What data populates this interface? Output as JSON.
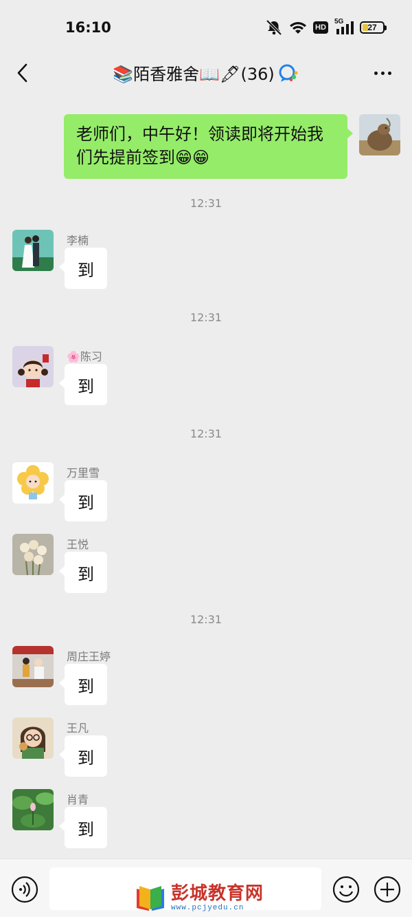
{
  "status_bar": {
    "time": "16:10",
    "network": "5G",
    "hd_label": "HD",
    "battery_level": "27",
    "battery_fraction": 0.27,
    "icons": [
      "mute-icon",
      "wifi-icon",
      "hd-icon",
      "signal-5g-icon",
      "battery-icon"
    ]
  },
  "header": {
    "title": "📚陌香雅舍📖🖋(36)",
    "back_icon": "back-chevron-icon",
    "more_icon": "more-dots-icon"
  },
  "messages": {
    "self": {
      "text": "老师们，中午好！领读即将开始我们先提前签到😁😁",
      "avatar": "capybara-photo"
    },
    "timestamps": [
      "12:31",
      "12:31",
      "12:31",
      "12:31"
    ],
    "group1": [
      {
        "sender": "李楠",
        "text": "到",
        "avatar": "couple-photo"
      }
    ],
    "group2": [
      {
        "sender": "🌸陈习",
        "text": "到",
        "avatar": "cartoon-girl"
      }
    ],
    "group3": [
      {
        "sender": "万里雪",
        "text": "到",
        "avatar": "flower-girl"
      },
      {
        "sender": "王悦",
        "text": "到",
        "avatar": "tulip-photo"
      }
    ],
    "group4": [
      {
        "sender": "周庄王婷",
        "text": "到",
        "avatar": "kids-photo"
      },
      {
        "sender": "王凡",
        "text": "到",
        "avatar": "cartoon-woman"
      },
      {
        "sender": "肖青",
        "text": "到",
        "avatar": "lotus-photo"
      }
    ]
  },
  "input_bar": {
    "icons": [
      "voice-icon",
      "emoji-icon",
      "plus-icon"
    ],
    "placeholder": ""
  },
  "watermark": {
    "title": "彭城教育网",
    "url": "www.pcjyedu.cn"
  },
  "colors": {
    "background": "#ededed",
    "self_bubble": "#95ec69",
    "other_bubble": "#ffffff",
    "timestamp": "#8a8a8a",
    "watermark_red": "#c8332b",
    "watermark_blue": "#1f6fb8"
  }
}
